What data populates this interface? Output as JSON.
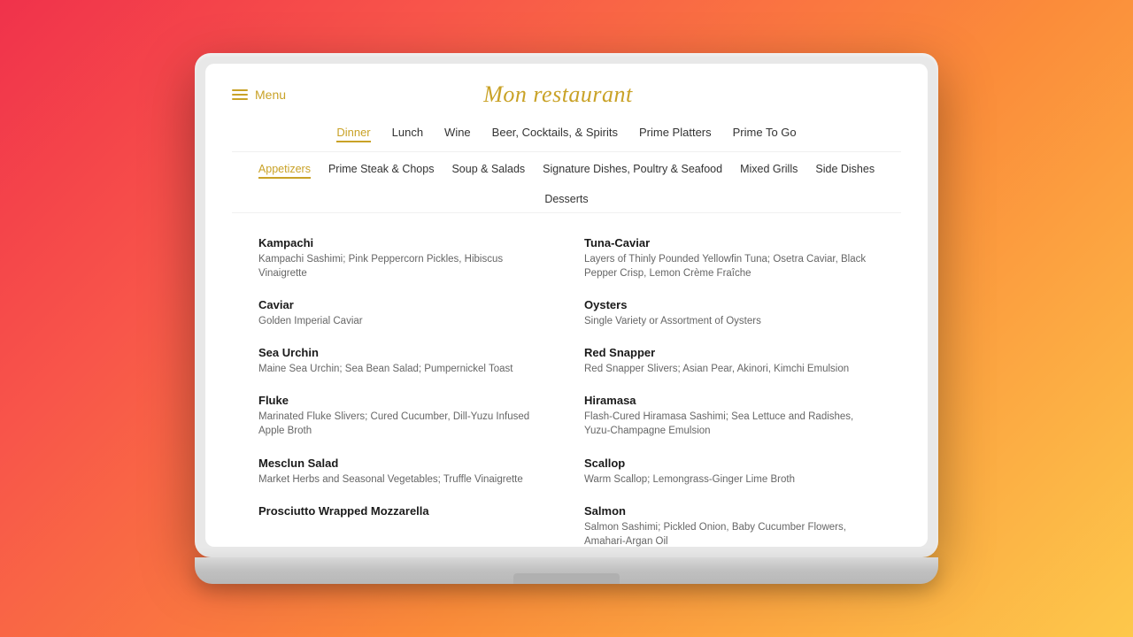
{
  "header": {
    "menu_label": "Menu",
    "restaurant_name": "Mon restaurant"
  },
  "main_nav": {
    "items": [
      {
        "label": "Dinner",
        "active": true
      },
      {
        "label": "Lunch",
        "active": false
      },
      {
        "label": "Wine",
        "active": false
      },
      {
        "label": "Beer, Cocktails, & Spirits",
        "active": false
      },
      {
        "label": "Prime Platters",
        "active": false
      },
      {
        "label": "Prime To Go",
        "active": false
      }
    ]
  },
  "sub_nav": {
    "items": [
      {
        "label": "Appetizers",
        "active": true
      },
      {
        "label": "Prime Steak & Chops",
        "active": false
      },
      {
        "label": "Soup & Salads",
        "active": false
      },
      {
        "label": "Signature Dishes, Poultry & Seafood",
        "active": false
      },
      {
        "label": "Mixed Grills",
        "active": false
      },
      {
        "label": "Side Dishes",
        "active": false
      },
      {
        "label": "Desserts",
        "active": false
      }
    ]
  },
  "menu_items": [
    {
      "col": "left",
      "name": "Kampachi",
      "desc": "Kampachi Sashimi; Pink Peppercorn Pickles, Hibiscus Vinaigrette"
    },
    {
      "col": "right",
      "name": "Tuna-Caviar",
      "desc": "Layers of Thinly Pounded Yellowfin Tuna; Osetra Caviar, Black Pepper Crisp, Lemon Crème Fraîche"
    },
    {
      "col": "left",
      "name": "Caviar",
      "desc": "Golden Imperial Caviar"
    },
    {
      "col": "right",
      "name": "Oysters",
      "desc": "Single Variety or Assortment of Oysters"
    },
    {
      "col": "left",
      "name": "Sea Urchin",
      "desc": "Maine Sea Urchin; Sea Bean Salad; Pumpernickel Toast"
    },
    {
      "col": "right",
      "name": "Red Snapper",
      "desc": "Red Snapper Slivers; Asian Pear, Akinori, Kimchi Emulsion"
    },
    {
      "col": "left",
      "name": "Fluke",
      "desc": "Marinated Fluke Slivers; Cured Cucumber, Dill-Yuzu Infused Apple Broth"
    },
    {
      "col": "right",
      "name": "Hiramasa",
      "desc": "Flash-Cured Hiramasa Sashimi; Sea Lettuce and Radishes, Yuzu-Champagne Emulsion"
    },
    {
      "col": "left",
      "name": "Mesclun Salad",
      "desc": "Market Herbs and Seasonal Vegetables; Truffle Vinaigrette"
    },
    {
      "col": "right",
      "name": "Scallop",
      "desc": "Warm Scallop; Lemongrass-Ginger Lime Broth"
    },
    {
      "col": "left",
      "name": "Prosciutto Wrapped Mozzarella",
      "desc": ""
    },
    {
      "col": "right",
      "name": "Salmon",
      "desc": "Salmon Sashimi; Pickled Onion, Baby Cucumber Flowers, Amahari-Argan Oil"
    }
  ],
  "colors": {
    "gold": "#c9a227",
    "text_dark": "#1a1a1a",
    "text_gray": "#666666",
    "bg_white": "#ffffff"
  }
}
